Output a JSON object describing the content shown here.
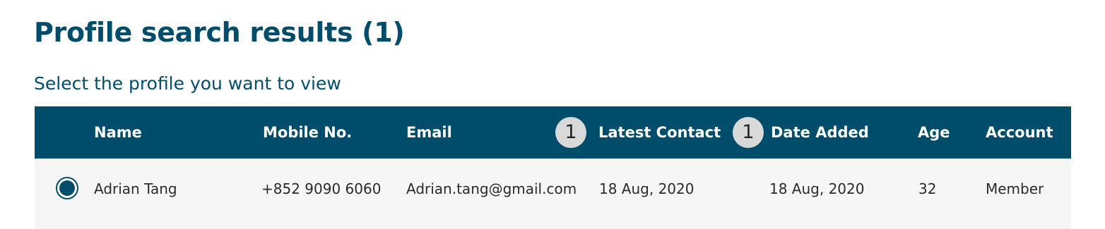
{
  "page": {
    "title": "Profile search results (1)",
    "subtitle": "Select the profile you want to view"
  },
  "table": {
    "columns": {
      "name": "Name",
      "mobile": "Mobile No.",
      "email": "Email",
      "latest_contact": "Latest Contact",
      "date_added": "Date Added",
      "age": "Age",
      "account": "Account"
    },
    "sort_badges": {
      "latest_contact": "1",
      "date_added": "1"
    },
    "rows": [
      {
        "selected": true,
        "name": "Adrian Tang",
        "mobile": "+852 9090 6060",
        "email": "Adrian.tang@gmail.com",
        "latest_contact": "18 Aug, 2020",
        "date_added": "18 Aug, 2020",
        "age": "32",
        "account": "Member"
      }
    ]
  },
  "colors": {
    "primary": "#004c6b",
    "row_background": "#f6f6f6",
    "badge_background": "#d9d9d9"
  }
}
